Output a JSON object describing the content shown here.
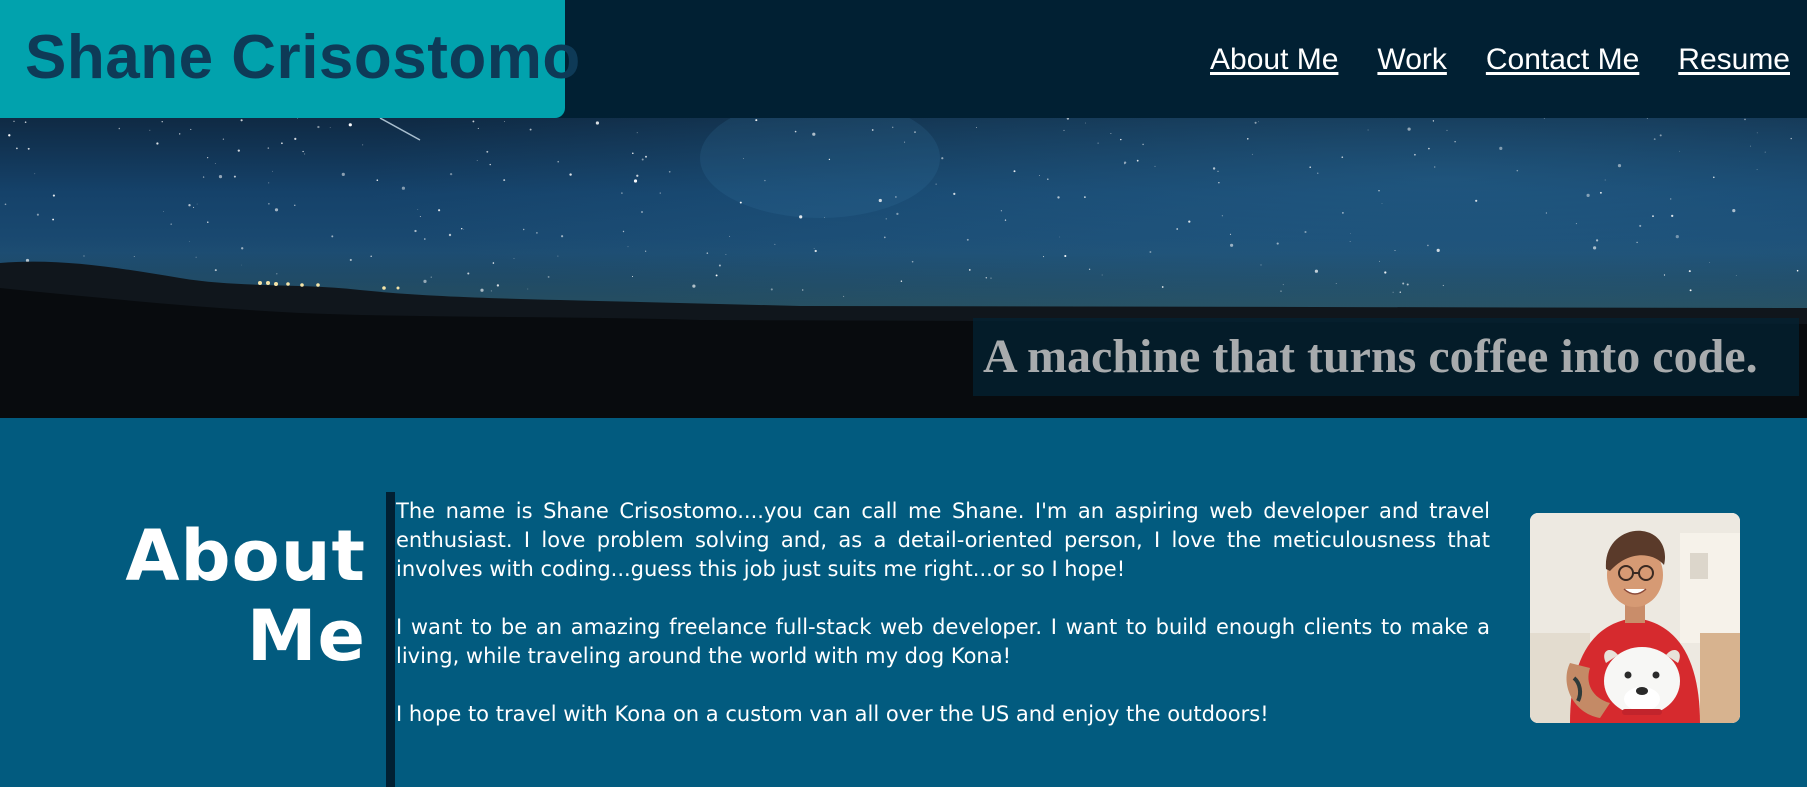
{
  "header": {
    "logo": "Shane Crisostomo",
    "nav": [
      {
        "label": "About Me"
      },
      {
        "label": "Work"
      },
      {
        "label": "Contact Me"
      },
      {
        "label": "Resume"
      }
    ]
  },
  "hero": {
    "tagline": "A machine that turns coffee into code."
  },
  "about": {
    "heading_line1": "About",
    "heading_line2": "Me",
    "paragraphs": [
      "The name is Shane Crisostomo....you can call me Shane. I'm an aspiring web developer and travel enthusiast. I love problem solving and, as a detail-oriented person, I love the meticulousness that involves with coding...guess this job just suits me right...or so I hope!",
      "I want to be an amazing freelance full-stack web developer. I want to build enough clients to make a living, while traveling around the world with my dog Kona!",
      "I hope to travel with Kona on a custom van all over the US and enjoy the outdoors!"
    ]
  },
  "colors": {
    "header_bg": "#012033",
    "logo_bg": "#01A2AD",
    "logo_text": "#0E3A57",
    "section_bg": "#025B7F",
    "tagline_text": "#A8ABAD"
  }
}
